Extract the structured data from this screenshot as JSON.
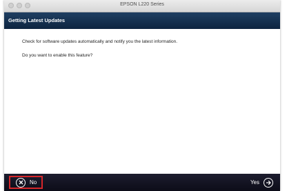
{
  "window": {
    "title": "EPSON L220 Series"
  },
  "header": {
    "title": "Getting Latest Updates"
  },
  "content": {
    "line1": "Check for software updates automatically and notify you the latest information.",
    "line2": "Do you want to enable this feature?"
  },
  "footer": {
    "no_label": "No",
    "yes_label": "Yes",
    "no_icon": "close-circle-icon",
    "yes_icon": "arrow-right-circle-icon",
    "highlight_color": "#d6262a"
  }
}
